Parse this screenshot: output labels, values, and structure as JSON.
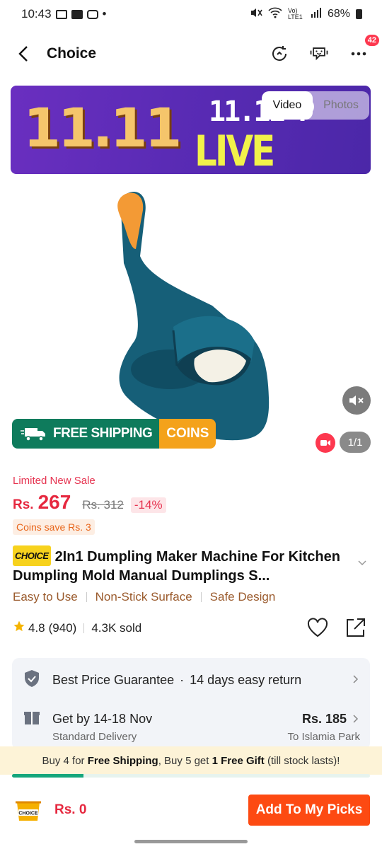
{
  "status_bar": {
    "time": "10:43",
    "network": "Vo) LTE1",
    "battery": "68%"
  },
  "app_bar": {
    "title": "Choice",
    "more_badge": "42"
  },
  "banner": {
    "line_left": "11.11",
    "line1": "11.11 P",
    "line2": "LIVE NOW!"
  },
  "media_toggle": {
    "video_label": "Video",
    "photos_label": "Photos"
  },
  "shipping_banner": {
    "free_label": "FREE SHIPPING",
    "coins_label": "COINS"
  },
  "image_counter": "1/1",
  "pricing": {
    "sale_label": "Limited New Sale",
    "currency": "Rs.",
    "price": "267",
    "original_price": "Rs. 312",
    "discount": "-14%",
    "coins_save": "Coins save Rs. 3"
  },
  "product": {
    "choice_tag": "CHOICE",
    "title": "2In1 Dumpling Maker Machine For Kitchen Dumpling Mold Manual Dumplings S..."
  },
  "features": [
    "Easy to Use",
    "Non-Stick Surface",
    "Safe Design"
  ],
  "rating": {
    "score": "4.8",
    "count": "(940)",
    "sold": "4.3K sold"
  },
  "services": {
    "guarantee": "Best Price Guarantee",
    "return": "14 days easy return",
    "delivery": "Get by 14-18 Nov",
    "delivery_price": "Rs. 185",
    "delivery_type": "Standard Delivery",
    "destination": "To Islamia Park"
  },
  "promo": {
    "part1": "Buy 4 for ",
    "bold1": "Free Shipping",
    "part2": ", Buy 5 get ",
    "bold2": "1 Free Gift",
    "part3": " (till stock lasts)!",
    "progress": 0.2
  },
  "bottom_bar": {
    "cart_label": "CHOICE",
    "cart_amount": "Rs. 0",
    "add_label": "Add To My Picks"
  },
  "colors": {
    "accent": "#fd4a12",
    "price": "#e6283f",
    "shipping_green": "#0e7b5c",
    "coins_orange": "#f4a21b"
  }
}
